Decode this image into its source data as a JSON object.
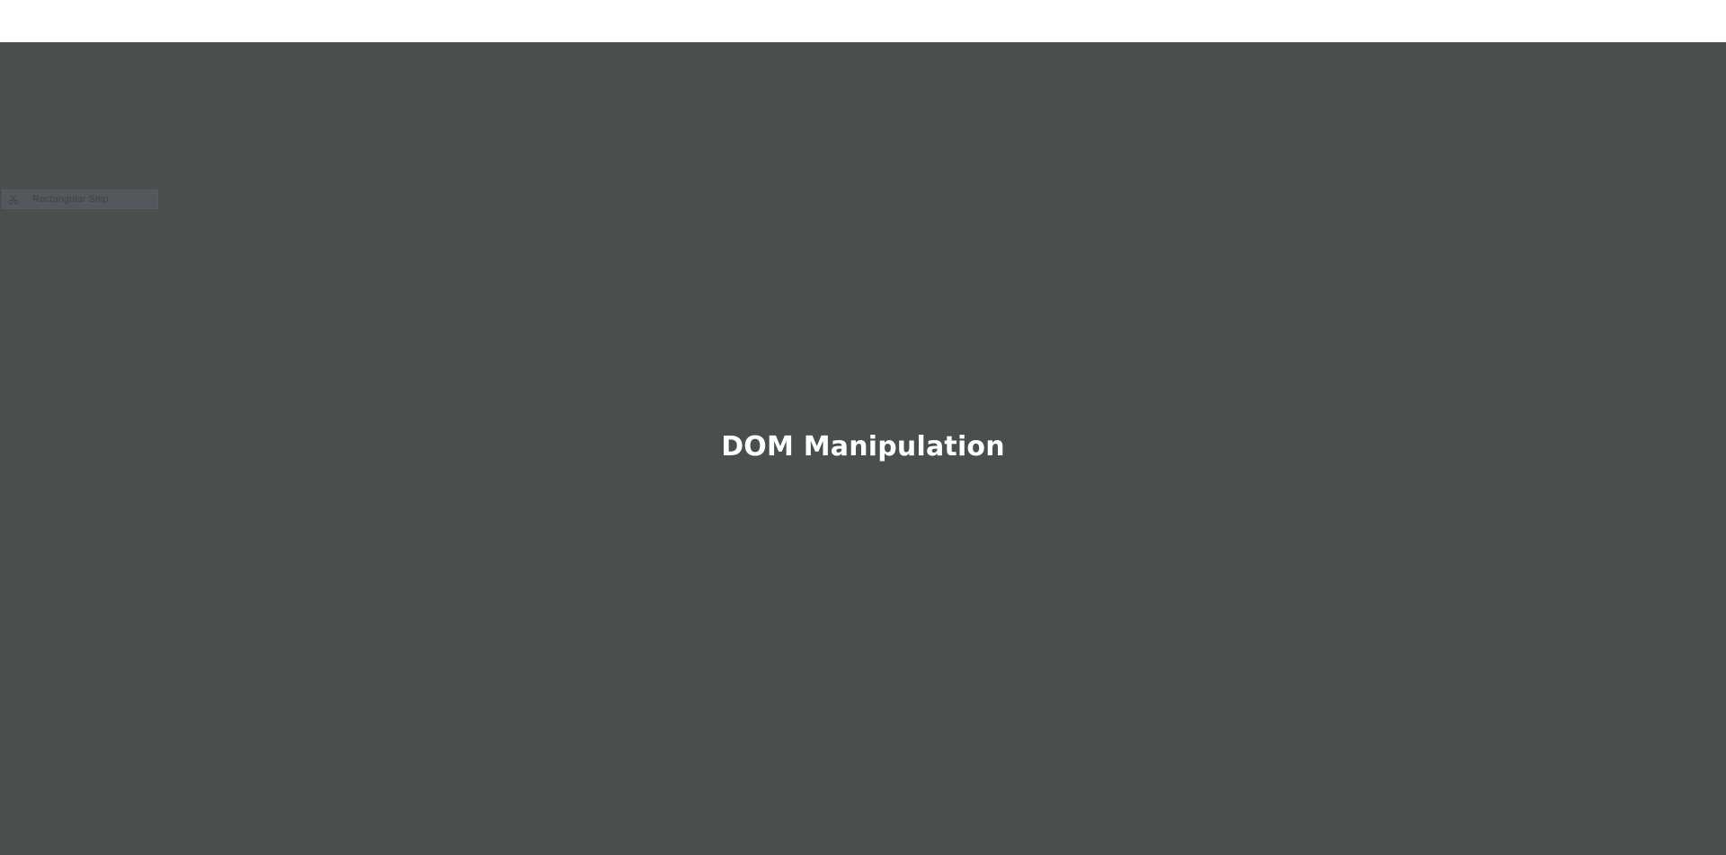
{
  "page": {
    "heading": "DOM Manipulation"
  },
  "snip_toolbar": {
    "mode_label": "Rectangular Snip",
    "icon": "scissors-icon"
  },
  "colors": {
    "background": "#4a4e4d",
    "top_bar": "#ffffff",
    "heading_text": "#ffffff",
    "snip_toolbar_bg": "#535a5d"
  }
}
